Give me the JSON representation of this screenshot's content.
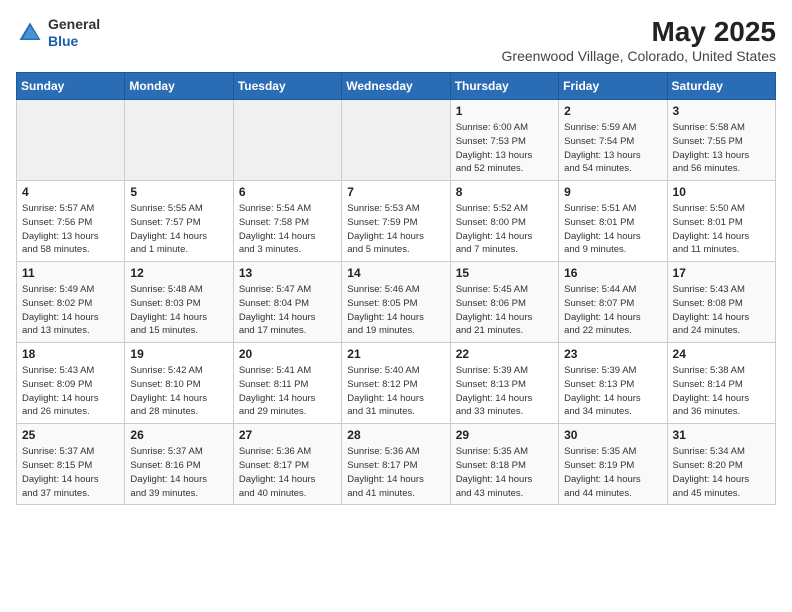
{
  "header": {
    "logo_line1": "General",
    "logo_line2": "Blue",
    "title": "May 2025",
    "subtitle": "Greenwood Village, Colorado, United States"
  },
  "weekdays": [
    "Sunday",
    "Monday",
    "Tuesday",
    "Wednesday",
    "Thursday",
    "Friday",
    "Saturday"
  ],
  "weeks": [
    [
      {
        "day": "",
        "info": ""
      },
      {
        "day": "",
        "info": ""
      },
      {
        "day": "",
        "info": ""
      },
      {
        "day": "",
        "info": ""
      },
      {
        "day": "1",
        "info": "Sunrise: 6:00 AM\nSunset: 7:53 PM\nDaylight: 13 hours\nand 52 minutes."
      },
      {
        "day": "2",
        "info": "Sunrise: 5:59 AM\nSunset: 7:54 PM\nDaylight: 13 hours\nand 54 minutes."
      },
      {
        "day": "3",
        "info": "Sunrise: 5:58 AM\nSunset: 7:55 PM\nDaylight: 13 hours\nand 56 minutes."
      }
    ],
    [
      {
        "day": "4",
        "info": "Sunrise: 5:57 AM\nSunset: 7:56 PM\nDaylight: 13 hours\nand 58 minutes."
      },
      {
        "day": "5",
        "info": "Sunrise: 5:55 AM\nSunset: 7:57 PM\nDaylight: 14 hours\nand 1 minute."
      },
      {
        "day": "6",
        "info": "Sunrise: 5:54 AM\nSunset: 7:58 PM\nDaylight: 14 hours\nand 3 minutes."
      },
      {
        "day": "7",
        "info": "Sunrise: 5:53 AM\nSunset: 7:59 PM\nDaylight: 14 hours\nand 5 minutes."
      },
      {
        "day": "8",
        "info": "Sunrise: 5:52 AM\nSunset: 8:00 PM\nDaylight: 14 hours\nand 7 minutes."
      },
      {
        "day": "9",
        "info": "Sunrise: 5:51 AM\nSunset: 8:01 PM\nDaylight: 14 hours\nand 9 minutes."
      },
      {
        "day": "10",
        "info": "Sunrise: 5:50 AM\nSunset: 8:01 PM\nDaylight: 14 hours\nand 11 minutes."
      }
    ],
    [
      {
        "day": "11",
        "info": "Sunrise: 5:49 AM\nSunset: 8:02 PM\nDaylight: 14 hours\nand 13 minutes."
      },
      {
        "day": "12",
        "info": "Sunrise: 5:48 AM\nSunset: 8:03 PM\nDaylight: 14 hours\nand 15 minutes."
      },
      {
        "day": "13",
        "info": "Sunrise: 5:47 AM\nSunset: 8:04 PM\nDaylight: 14 hours\nand 17 minutes."
      },
      {
        "day": "14",
        "info": "Sunrise: 5:46 AM\nSunset: 8:05 PM\nDaylight: 14 hours\nand 19 minutes."
      },
      {
        "day": "15",
        "info": "Sunrise: 5:45 AM\nSunset: 8:06 PM\nDaylight: 14 hours\nand 21 minutes."
      },
      {
        "day": "16",
        "info": "Sunrise: 5:44 AM\nSunset: 8:07 PM\nDaylight: 14 hours\nand 22 minutes."
      },
      {
        "day": "17",
        "info": "Sunrise: 5:43 AM\nSunset: 8:08 PM\nDaylight: 14 hours\nand 24 minutes."
      }
    ],
    [
      {
        "day": "18",
        "info": "Sunrise: 5:43 AM\nSunset: 8:09 PM\nDaylight: 14 hours\nand 26 minutes."
      },
      {
        "day": "19",
        "info": "Sunrise: 5:42 AM\nSunset: 8:10 PM\nDaylight: 14 hours\nand 28 minutes."
      },
      {
        "day": "20",
        "info": "Sunrise: 5:41 AM\nSunset: 8:11 PM\nDaylight: 14 hours\nand 29 minutes."
      },
      {
        "day": "21",
        "info": "Sunrise: 5:40 AM\nSunset: 8:12 PM\nDaylight: 14 hours\nand 31 minutes."
      },
      {
        "day": "22",
        "info": "Sunrise: 5:39 AM\nSunset: 8:13 PM\nDaylight: 14 hours\nand 33 minutes."
      },
      {
        "day": "23",
        "info": "Sunrise: 5:39 AM\nSunset: 8:13 PM\nDaylight: 14 hours\nand 34 minutes."
      },
      {
        "day": "24",
        "info": "Sunrise: 5:38 AM\nSunset: 8:14 PM\nDaylight: 14 hours\nand 36 minutes."
      }
    ],
    [
      {
        "day": "25",
        "info": "Sunrise: 5:37 AM\nSunset: 8:15 PM\nDaylight: 14 hours\nand 37 minutes."
      },
      {
        "day": "26",
        "info": "Sunrise: 5:37 AM\nSunset: 8:16 PM\nDaylight: 14 hours\nand 39 minutes."
      },
      {
        "day": "27",
        "info": "Sunrise: 5:36 AM\nSunset: 8:17 PM\nDaylight: 14 hours\nand 40 minutes."
      },
      {
        "day": "28",
        "info": "Sunrise: 5:36 AM\nSunset: 8:17 PM\nDaylight: 14 hours\nand 41 minutes."
      },
      {
        "day": "29",
        "info": "Sunrise: 5:35 AM\nSunset: 8:18 PM\nDaylight: 14 hours\nand 43 minutes."
      },
      {
        "day": "30",
        "info": "Sunrise: 5:35 AM\nSunset: 8:19 PM\nDaylight: 14 hours\nand 44 minutes."
      },
      {
        "day": "31",
        "info": "Sunrise: 5:34 AM\nSunset: 8:20 PM\nDaylight: 14 hours\nand 45 minutes."
      }
    ]
  ]
}
